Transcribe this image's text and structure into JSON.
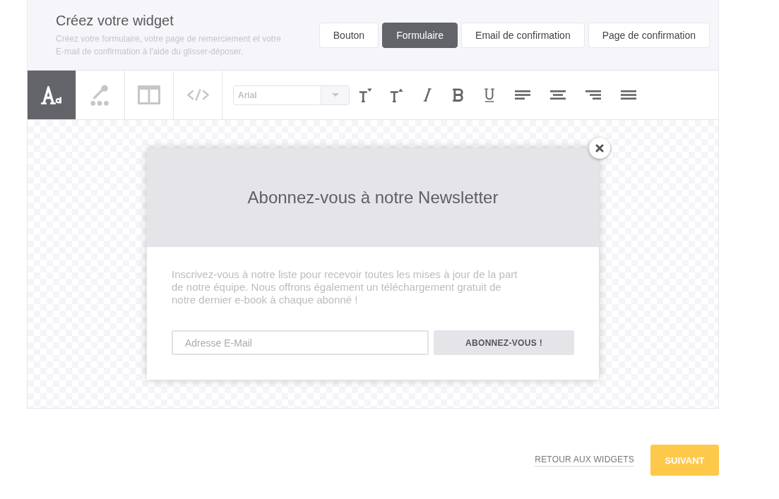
{
  "header": {
    "title": "Créez votre widget",
    "subtitle": "Créez votre formulaire, votre page de remerciement et votre E-mail de confirmation à l'aide du glisser-déposer."
  },
  "tabs": [
    {
      "label": "Bouton",
      "selected": false
    },
    {
      "label": "Formulaire",
      "selected": true
    },
    {
      "label": "Email de confirmation",
      "selected": false
    },
    {
      "label": "Page de confirmation",
      "selected": false
    }
  ],
  "tool_tabs": [
    {
      "kind": "text",
      "selected": true
    },
    {
      "kind": "color",
      "selected": false
    },
    {
      "kind": "layout",
      "selected": false
    },
    {
      "kind": "code",
      "selected": false
    }
  ],
  "font_select": {
    "value": "Arial"
  },
  "popup": {
    "title": "Abonnez-vous à notre Newsletter",
    "text": "Inscrivez-vous à notre liste pour recevoir toutes les mises à jour de la part de notre équipe. Nous offrons également un téléchargement gratuit de notre dernier e-book à chaque abonné !",
    "email_field": {
      "placeholder": "Adresse E-Mail"
    },
    "button": "ABONNEZ-VOUS !"
  },
  "footer": {
    "back_link": "RETOUR AUX WIDGETS",
    "next_button": "SUIVANT"
  }
}
